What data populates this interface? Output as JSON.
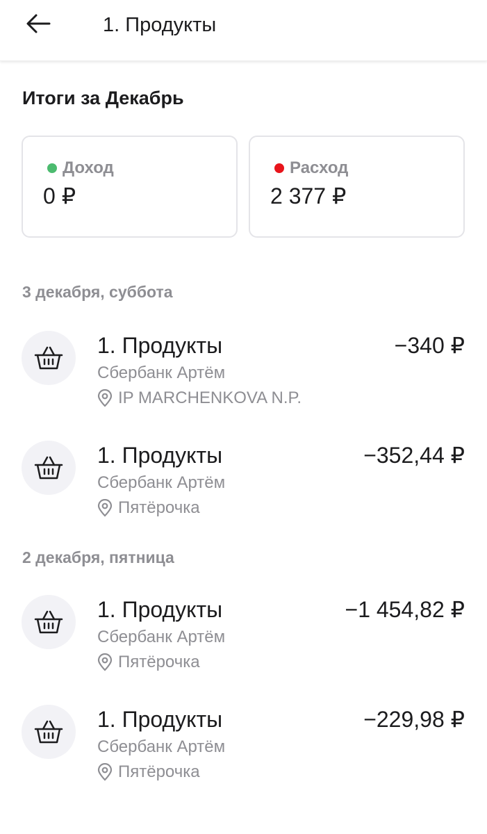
{
  "header": {
    "title": "1. Продукты",
    "back_icon": "arrow-left-icon"
  },
  "summary": {
    "title": "Итоги за Декабрь",
    "income": {
      "label": "Доход",
      "value": "0 ₽",
      "dot_color": "#4cbb6f"
    },
    "expense": {
      "label": "Расход",
      "value": "2 377 ₽",
      "dot_color": "#e8141b"
    }
  },
  "groups": [
    {
      "date": "3 декабря, суббота",
      "transactions": [
        {
          "category": "1. Продукты",
          "account": "Сбербанк Артём",
          "place": "IP MARCHENKOVA N.P.",
          "amount": "−340 ₽",
          "icon": "basket-icon"
        },
        {
          "category": "1. Продукты",
          "account": "Сбербанк Артём",
          "place": "Пятёрочка",
          "amount": "−352,44 ₽",
          "icon": "basket-icon"
        }
      ]
    },
    {
      "date": "2 декабря, пятница",
      "transactions": [
        {
          "category": "1. Продукты",
          "account": "Сбербанк Артём",
          "place": "Пятёрочка",
          "amount": "−1 454,82 ₽",
          "icon": "basket-icon"
        },
        {
          "category": "1. Продукты",
          "account": "Сбербанк Артём",
          "place": "Пятёрочка",
          "amount": "−229,98 ₽",
          "icon": "basket-icon"
        }
      ]
    }
  ]
}
